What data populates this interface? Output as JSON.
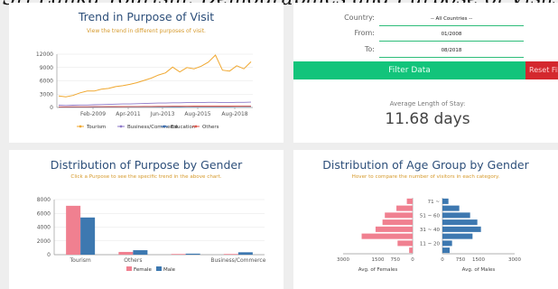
{
  "page": {
    "title": "Sri Lanka Tourism: Demographics and Purpose of Visit"
  },
  "trend_card": {
    "title": "Trend in Purpose of Visit",
    "subtitle": "View the trend in different purposes of visit."
  },
  "filter_card": {
    "country_label": "Country:",
    "country_value": "-- All Countries --",
    "from_label": "From:",
    "from_value": "01/2008",
    "to_label": "To:",
    "to_value": "08/2018",
    "filter_button": "Filter Data",
    "reset_button": "Reset Filter",
    "stay_label": "Average Length of Stay:",
    "stay_value": "11.68 days"
  },
  "purpose_card": {
    "title": "Distribution of Purpose by Gender",
    "subtitle": "Click a Purpose to see the specific trend in the above chart."
  },
  "age_card": {
    "title": "Distribution of Age Group by Gender",
    "subtitle": "Hover to compare the number of visitors in each category."
  },
  "chart_data": [
    {
      "type": "line",
      "ylim": [
        0,
        12000
      ],
      "y_ticks": [
        "0",
        "3000",
        "6000",
        "9000",
        "12000"
      ],
      "x_ticks": [
        "Feb-2009",
        "Apr-2011",
        "Jun-2013",
        "Aug-2015",
        "Aug-2018"
      ],
      "legend_position": "bottom",
      "colors": {
        "Tourism": "#f0a830",
        "Business/Commerce": "#8e79c9",
        "Education": "#3b6fb5",
        "Others": "#e05a4f"
      },
      "series": [
        {
          "name": "Tourism",
          "values": [
            2600,
            2400,
            2700,
            3300,
            3700,
            3700,
            4100,
            4300,
            4700,
            4900,
            5200,
            5600,
            6100,
            6600,
            7300,
            7800,
            9100,
            8000,
            9000,
            8700,
            9300,
            10200,
            11800,
            8400,
            8200,
            9400,
            8700,
            10300
          ]
        },
        {
          "name": "Business/Commerce",
          "values": [
            500,
            450,
            500,
            550,
            550,
            600,
            650,
            700,
            750,
            800,
            800,
            850,
            900,
            950,
            1000,
            1000,
            1050,
            1050,
            1100,
            1100,
            1100,
            1150,
            1150,
            1100,
            1100,
            1150,
            1150,
            1200
          ]
        },
        {
          "name": "Education",
          "values": [
            100,
            100,
            100,
            120,
            120,
            130,
            140,
            150,
            150,
            160,
            170,
            170,
            180,
            190,
            200,
            200,
            210,
            210,
            220,
            220,
            230,
            230,
            240,
            230,
            230,
            240,
            240,
            250
          ]
        },
        {
          "name": "Others",
          "values": [
            150,
            150,
            160,
            170,
            170,
            180,
            190,
            200,
            210,
            210,
            220,
            230,
            240,
            250,
            260,
            270,
            280,
            280,
            290,
            300,
            300,
            310,
            320,
            310,
            300,
            310,
            320,
            330
          ]
        }
      ]
    },
    {
      "type": "bar",
      "categories": [
        "Tourism",
        "Others",
        "Education",
        "Business/Commerce"
      ],
      "x_tick_labels": [
        "Tourism",
        "Others",
        "",
        "Business/Commerce"
      ],
      "ylim": [
        0,
        8000
      ],
      "y_ticks": [
        "0",
        "2000",
        "4000",
        "6000",
        "8000"
      ],
      "legend_position": "bottom",
      "colors": {
        "Female": "#f08090",
        "Male": "#3d78b0"
      },
      "series": [
        {
          "name": "Female",
          "values": [
            7100,
            400,
            100,
            100
          ]
        },
        {
          "name": "Male",
          "values": [
            5400,
            650,
            150,
            350
          ]
        }
      ]
    },
    {
      "type": "bar",
      "orientation": "horizontal",
      "categories": [
        "71 ~",
        "61 ~ 70",
        "51 ~ 60",
        "41 ~ 50",
        "31 ~ 40",
        "21 ~ 30",
        "11 ~ 20",
        "0 ~ 10"
      ],
      "y_tick_labels": [
        "71 ~",
        "",
        "51 ~ 60",
        "",
        "31 ~ 40",
        "",
        "11 ~ 20",
        ""
      ],
      "colors": {
        "Avg. of Females": "#f08090",
        "Avg. of Males": "#3d78b0"
      },
      "female_axis": {
        "label": "Avg. of Females",
        "ticks": [
          "3000",
          "1500",
          "750",
          "0"
        ]
      },
      "male_axis": {
        "label": "Avg. of Males",
        "ticks": [
          "0",
          "750",
          "1500",
          "3000"
        ]
      },
      "series": [
        {
          "name": "Avg. of Females",
          "values": [
            250,
            700,
            1200,
            1300,
            1600,
            2200,
            650,
            150
          ]
        },
        {
          "name": "Avg. of Males",
          "values": [
            250,
            700,
            1150,
            1450,
            1600,
            1250,
            400,
            300
          ]
        }
      ]
    }
  ]
}
